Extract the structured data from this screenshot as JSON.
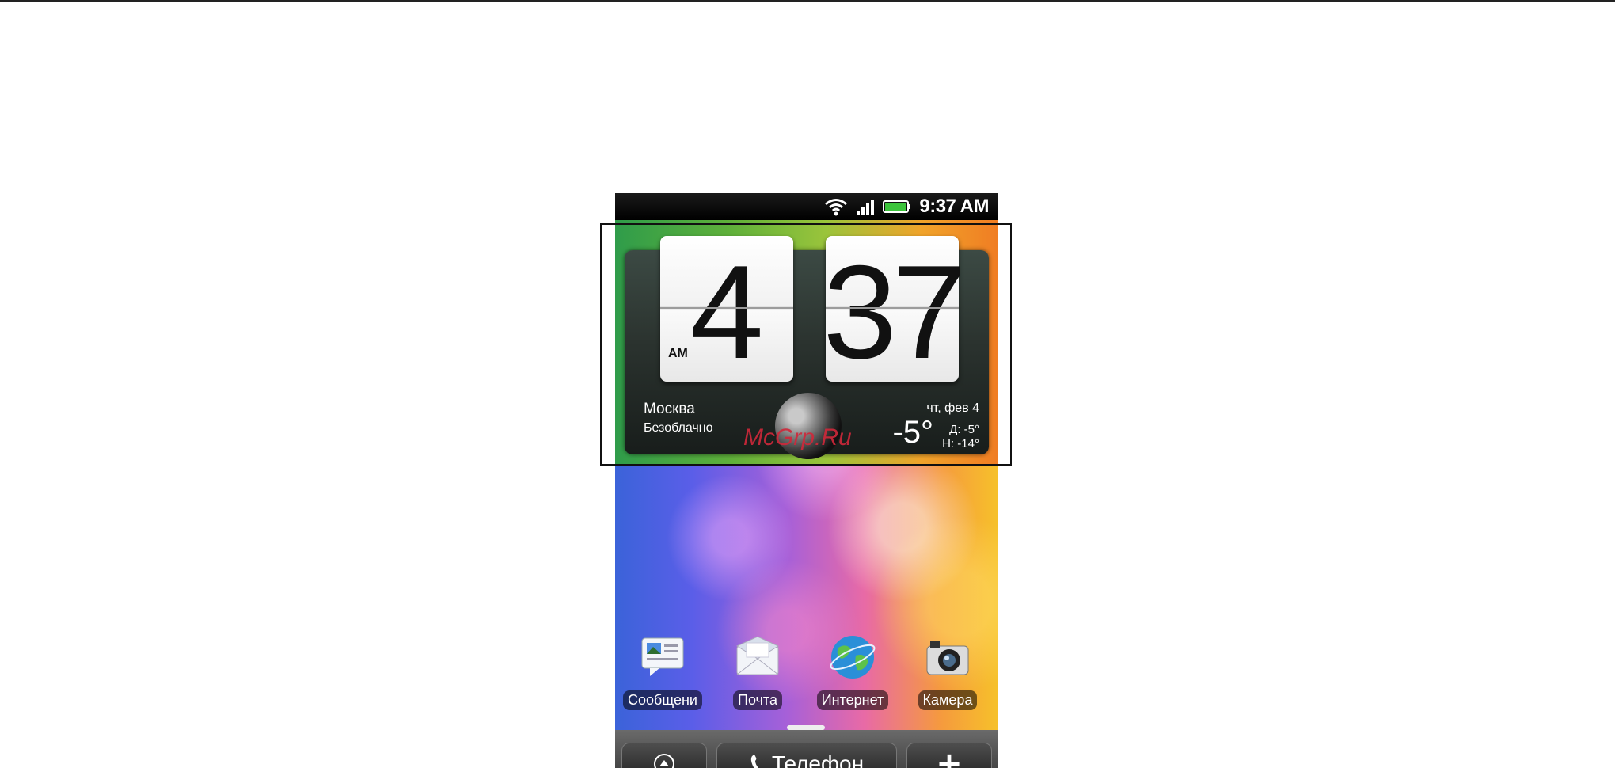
{
  "status_bar": {
    "time": "9:37 AM",
    "wifi_icon": "wifi-icon",
    "signal_icon": "signal-icon",
    "battery_icon": "battery-icon",
    "battery_color": "#3cc43c"
  },
  "clock": {
    "hour": "4",
    "minute": "37",
    "ampm": "AM"
  },
  "weather": {
    "city": "Москва",
    "condition": "Безоблачно",
    "date": "чт, фев 4",
    "temperature": "-5°",
    "high": "Д:  -5°",
    "low": "Н: -14°",
    "icon": "moon-icon"
  },
  "watermark": "McGrp.Ru",
  "apps": [
    {
      "label": "Сообщени",
      "icon": "messages-icon"
    },
    {
      "label": "Почта",
      "icon": "mail-icon"
    },
    {
      "label": "Интернет",
      "icon": "globe-icon"
    },
    {
      "label": "Камера",
      "icon": "camera-icon"
    }
  ],
  "dock": {
    "all_apps_icon": "all-apps-icon",
    "phone_label": "Телефон",
    "phone_icon": "phone-icon",
    "add_label": "+"
  }
}
